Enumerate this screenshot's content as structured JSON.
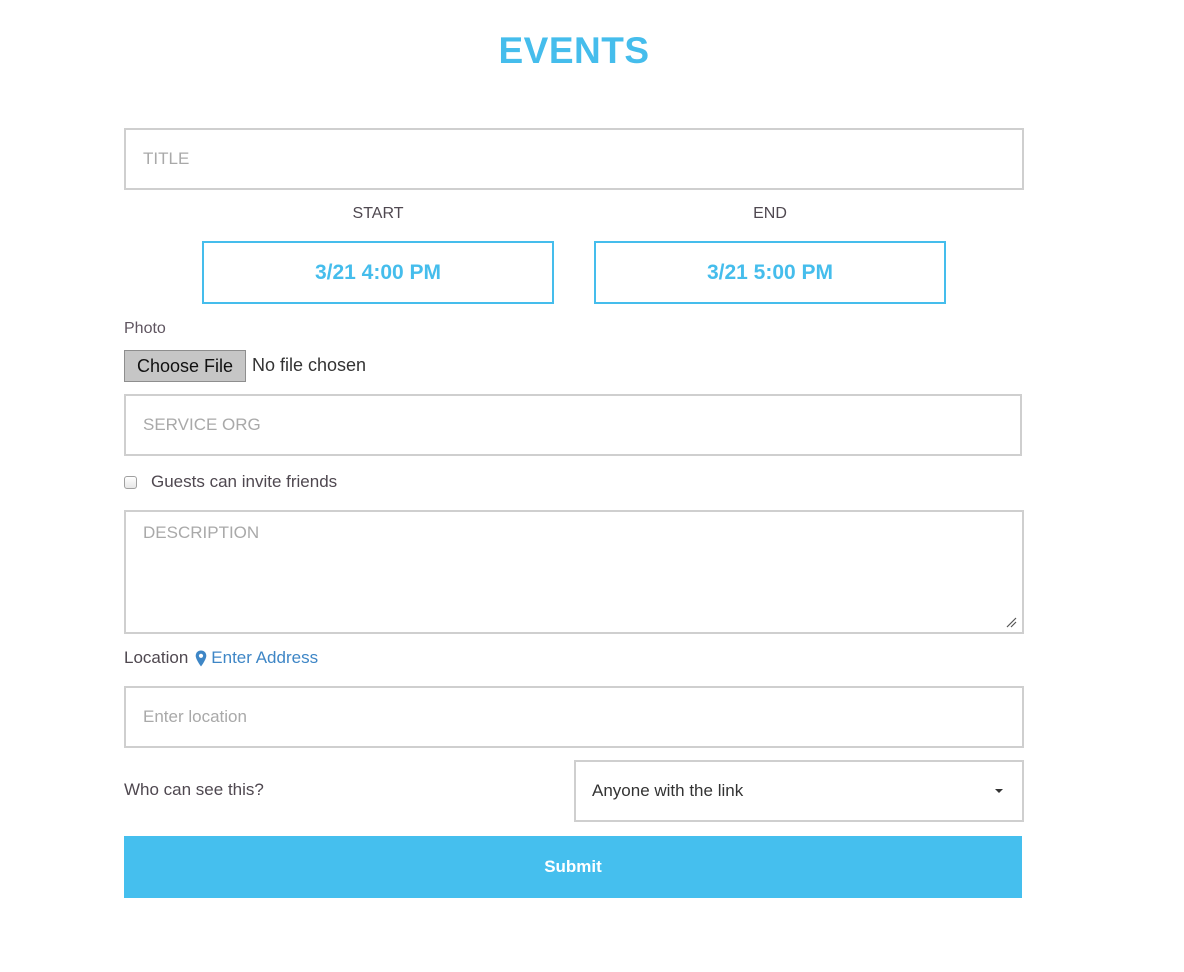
{
  "page": {
    "title": "EVENTS"
  },
  "form": {
    "title_placeholder": "TITLE",
    "start": {
      "label": "START",
      "value": "3/21 4:00 PM"
    },
    "end": {
      "label": "END",
      "value": "3/21 5:00 PM"
    },
    "photo": {
      "label": "Photo",
      "button_label": "Choose File",
      "status": "No file chosen"
    },
    "service_org_placeholder": "SERVICE ORG",
    "guests_invite": {
      "label": "Guests can invite friends",
      "checked": false
    },
    "description_placeholder": "DESCRIPTION",
    "location": {
      "label": "Location",
      "icon": "map-pin-icon",
      "link_label": "Enter Address",
      "placeholder": "Enter location"
    },
    "visibility": {
      "label": "Who can see this?",
      "selected": "Anyone with the link"
    },
    "submit_label": "Submit"
  },
  "colors": {
    "accent": "#45bdec",
    "link": "#3e86c6",
    "border": "#cfcfcf"
  }
}
